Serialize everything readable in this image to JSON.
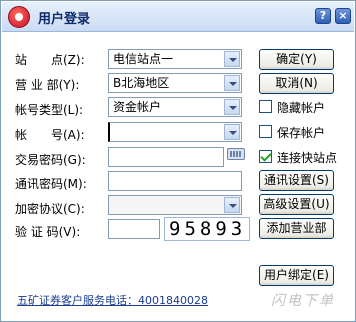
{
  "window": {
    "title": "用户登录",
    "help_label": "?",
    "close_label": "×"
  },
  "form": {
    "station": {
      "label": "站　　点(Z):",
      "value": "电信站点一"
    },
    "branch": {
      "label": "营 业 部(Y):",
      "value": "B北海地区"
    },
    "account_type": {
      "label": "帐号类型(L):",
      "value": "资金帐户"
    },
    "account": {
      "label": "帐　　号(A):",
      "value": ""
    },
    "trade_password": {
      "label": "交易密码(G):",
      "value": ""
    },
    "comm_password": {
      "label": "通讯密码(M):",
      "value": ""
    },
    "encrypt_protocol": {
      "label": "加密协议(C):",
      "value": ""
    },
    "captcha": {
      "label": "验 证 码(V):",
      "value": "",
      "code": "95893"
    }
  },
  "buttons": {
    "ok": "确定(Y)",
    "cancel": "取消(N)",
    "comm_settings": "通讯设置(S)",
    "advanced_settings": "高级设置(U)",
    "add_branch": "添加营业部",
    "user_bind": "用户绑定(E)"
  },
  "checkboxes": {
    "hide_account": {
      "label": "隐藏帐户",
      "checked": false
    },
    "save_account": {
      "label": "保存帐户",
      "checked": false
    },
    "connect_fast_station": {
      "label": "连接快站点",
      "checked": true
    }
  },
  "footer": {
    "hotline": "五矿证券客户服务电话：4001840028",
    "watermark": "闪电下单"
  }
}
